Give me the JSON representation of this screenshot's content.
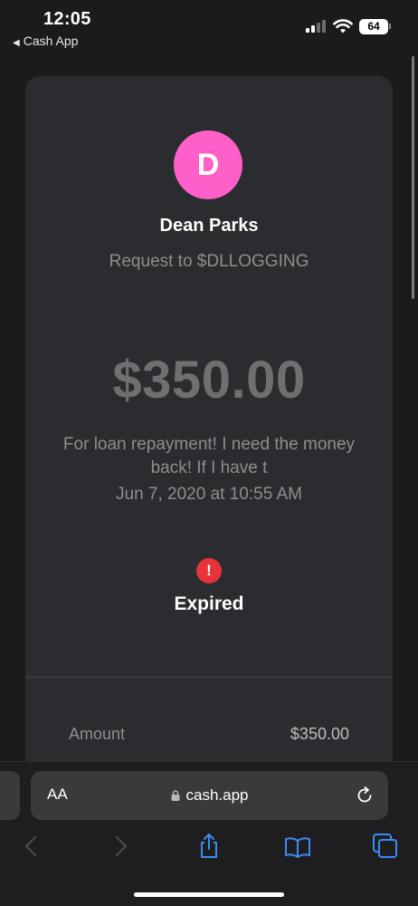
{
  "status_bar": {
    "time": "12:05",
    "back_app": "Cash App",
    "battery": "64"
  },
  "payment": {
    "avatar_initial": "D",
    "name": "Dean Parks",
    "request_to": "Request to $DLLOGGING",
    "amount": "$350.00",
    "note": "For loan repayment! I need the money back! If I have t",
    "date": "Jun 7, 2020 at 10:55 AM",
    "status": "Expired",
    "details": [
      {
        "label": "Amount",
        "value": "$350.00"
      }
    ]
  },
  "browser": {
    "text_size_label": "AA",
    "url": "cash.app"
  },
  "colors": {
    "avatar": "#ff5fc8",
    "alert": "#e8333b",
    "toolbar_accent": "#3b8cf5"
  }
}
